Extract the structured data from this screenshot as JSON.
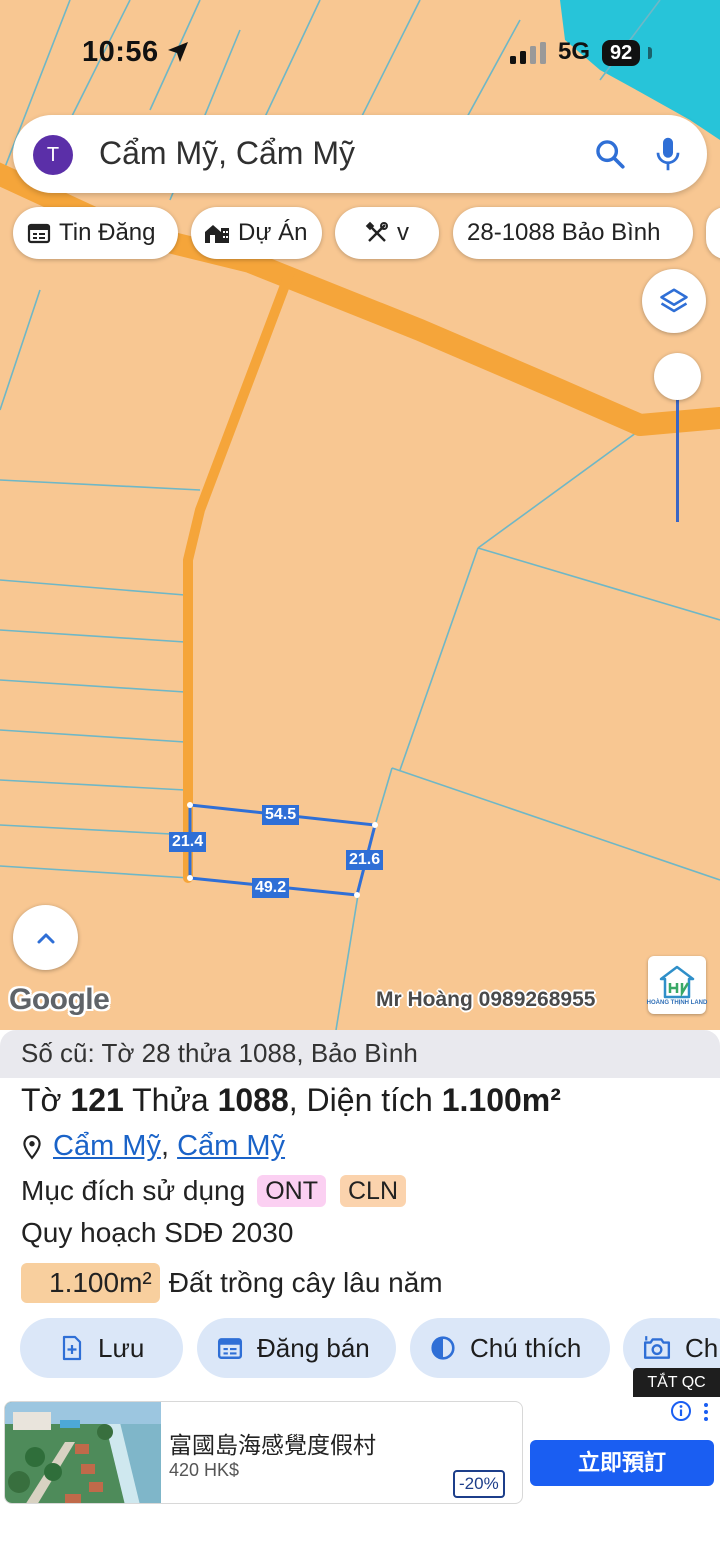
{
  "status_bar": {
    "time": "10:56",
    "network": "5G",
    "battery": "92"
  },
  "search": {
    "avatar_letter": "T",
    "query": "Cẩm Mỹ, Cẩm Mỹ"
  },
  "chips": [
    {
      "label": "Tin Đăng",
      "icon": "calendar-icon"
    },
    {
      "label": "Dự Án",
      "icon": "buildings-icon"
    },
    {
      "label": "v",
      "icon": "tools-icon"
    },
    {
      "label": "28-1088 Bảo Bình",
      "icon": ""
    }
  ],
  "map": {
    "plot_dimensions": {
      "top": "54.5",
      "left": "21.4",
      "right": "21.6",
      "bottom": "49.2"
    },
    "google_logo": "Google",
    "watermark": "Mr Hoàng 0989268955",
    "brand_logo_text": "HOÀNG THỊNH LAND",
    "colors": {
      "land": "#f8c792",
      "road": "#f5a53a",
      "parcel_lines": "#6fb7c6",
      "water": "#27c4d9",
      "plot_outline": "#2f6fd6"
    }
  },
  "parcel": {
    "old_info": "Số cũ: Tờ 28 thửa 1088, Bảo Bình",
    "sheet_label": "Tờ",
    "sheet_no": "121",
    "lot_label": "Thửa",
    "lot_no": "1088",
    "area_label": "Diện tích",
    "area": "1.100m²",
    "location_commune": "Cẩm Mỹ",
    "location_district": "Cẩm Mỹ",
    "purpose_label": "Mục đích sử dụng",
    "purpose_tags": [
      "ONT",
      "CLN"
    ],
    "plan_label": "Quy hoạch SDĐ 2030",
    "plan_area": "1.100m²",
    "plan_use": "Đất trồng cây lâu năm"
  },
  "actions": [
    {
      "label": "Lưu",
      "icon": "save-plus-icon"
    },
    {
      "label": "Đăng bán",
      "icon": "calendar-icon"
    },
    {
      "label": "Chú thích",
      "icon": "contrast-icon"
    },
    {
      "label": "Ch",
      "icon": "camera-icon"
    }
  ],
  "ad": {
    "close_label": "TẮT QC",
    "title": "富國島海感覺度假村",
    "price": "420 HK$",
    "discount": "-20%",
    "cta": "立即預訂"
  }
}
